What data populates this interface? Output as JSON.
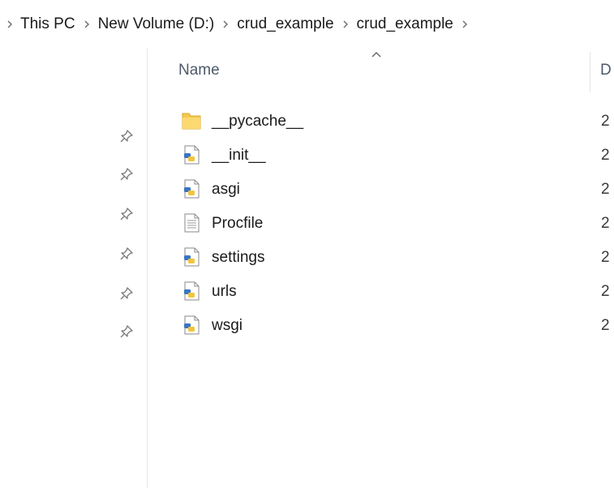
{
  "breadcrumb": {
    "items": [
      "This PC",
      "New Volume (D:)",
      "crud_example",
      "crud_example"
    ],
    "separator_icon": "chevron-right-icon"
  },
  "columns": {
    "name": "Name",
    "date_partial": "D"
  },
  "files": [
    {
      "name": "__pycache__",
      "type": "folder",
      "date_partial": "2"
    },
    {
      "name": "__init__",
      "type": "python",
      "date_partial": "2"
    },
    {
      "name": "asgi",
      "type": "python",
      "date_partial": "2"
    },
    {
      "name": "Procfile",
      "type": "text",
      "date_partial": "2"
    },
    {
      "name": "settings",
      "type": "python",
      "date_partial": "2"
    },
    {
      "name": "urls",
      "type": "python",
      "date_partial": "2"
    },
    {
      "name": "wsgi",
      "type": "python",
      "date_partial": "2"
    }
  ],
  "nav_pins_count": 6,
  "colors": {
    "folder": "#f5c84c",
    "python_blue": "#3a75c4",
    "python_yellow": "#f2c53d",
    "pin": "#7a7a7a"
  }
}
